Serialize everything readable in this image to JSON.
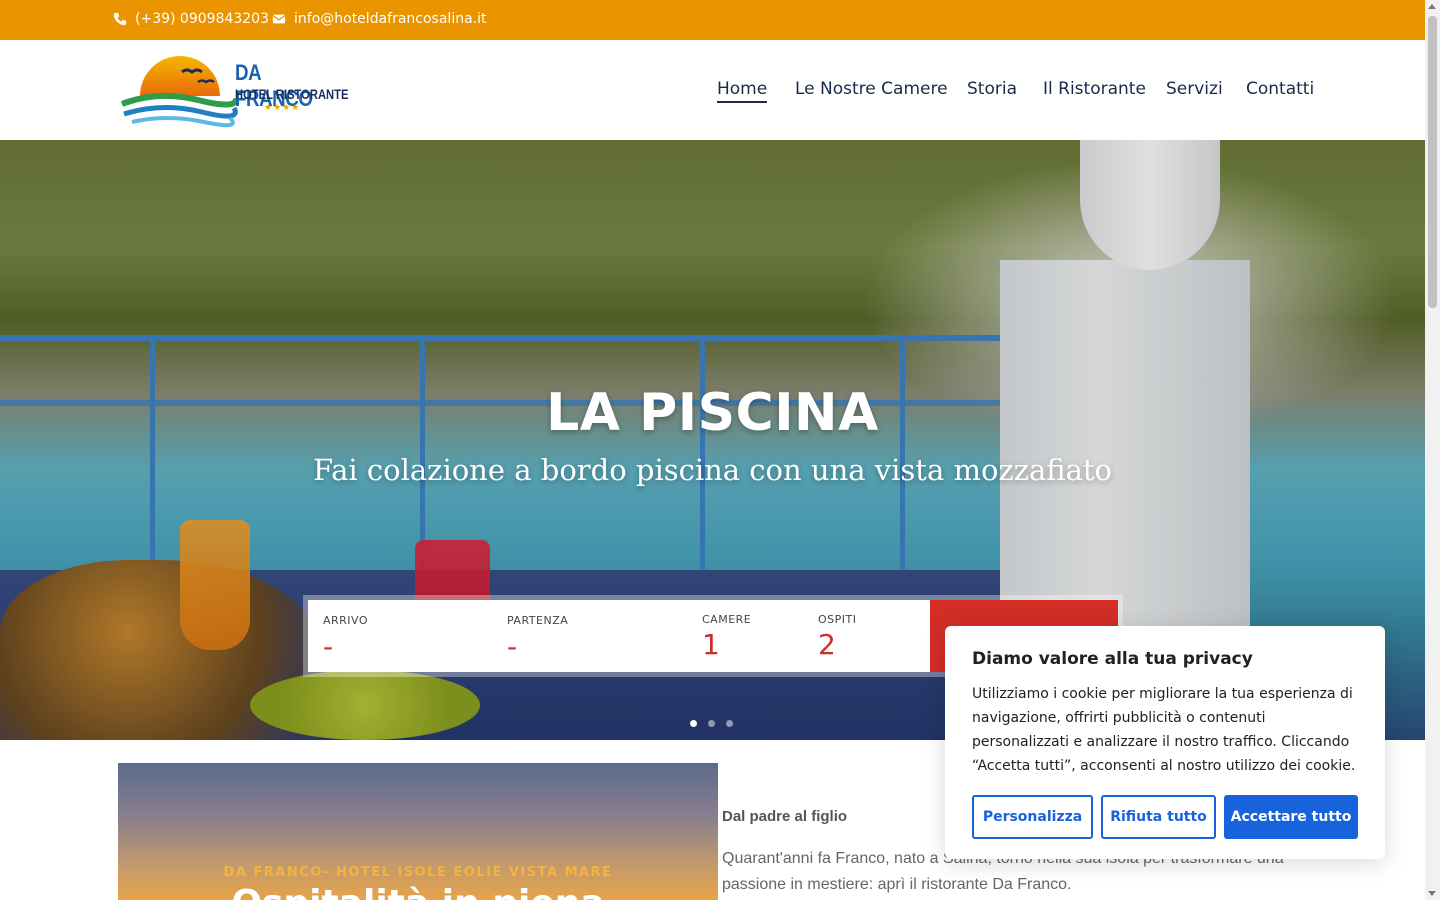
{
  "topbar": {
    "phone": "(+39) 0909843203",
    "email": "info@hoteldafrancosalina.it",
    "phone_icon": "phone-icon",
    "email_icon": "envelope-icon",
    "background": "#ea9400"
  },
  "logo": {
    "line1": "DA FRANCO",
    "line2": "HOTEL RISTORANTE",
    "stars": "★★★★"
  },
  "nav": {
    "items": [
      {
        "label": "Home",
        "active": true
      },
      {
        "label": "Le Nostre Camere"
      },
      {
        "label": "Storia"
      },
      {
        "label": "Il Ristorante"
      },
      {
        "label": "Servizi"
      },
      {
        "label": "Contatti"
      }
    ]
  },
  "hero": {
    "title": "LA PISCINA",
    "subtitle": "Fai colazione a bordo piscina con una vista mozzafiato",
    "slides_total": 3,
    "slide_active": 1
  },
  "booking": {
    "arrivo_label": "ARRIVO",
    "arrivo_value": "-",
    "partenza_label": "PARTENZA",
    "partenza_value": "-",
    "camere_label": "CAMERE",
    "camere_value": "1",
    "ospiti_label": "OSPITI",
    "ospiti_value": "2",
    "accent": "#d22e26"
  },
  "promo": {
    "kicker": "DA FRANCO- HOTEL ISOLE EOLIE VISTA MARE",
    "headline": "Ospitalità in piena"
  },
  "story": {
    "title": "Dal padre al figlio",
    "text": "Quarant'anni fa Franco, nato a Salina, tornò nella sua isola per trasformare una passione in mestiere: aprì il ristorante Da Franco."
  },
  "cookie": {
    "title": "Diamo valore alla tua privacy",
    "body": "Utilizziamo i cookie per migliorare la tua esperienza di navigazione, offrirti pubblicità o contenuti personalizzati e analizzare il nostro traffico. Cliccando “Accetta tutti”, acconsenti al nostro utilizzo dei cookie.",
    "customize": "Personalizza",
    "reject": "Rifiuta tutto",
    "accept": "Accettare tutto",
    "accent": "#1863dc"
  }
}
